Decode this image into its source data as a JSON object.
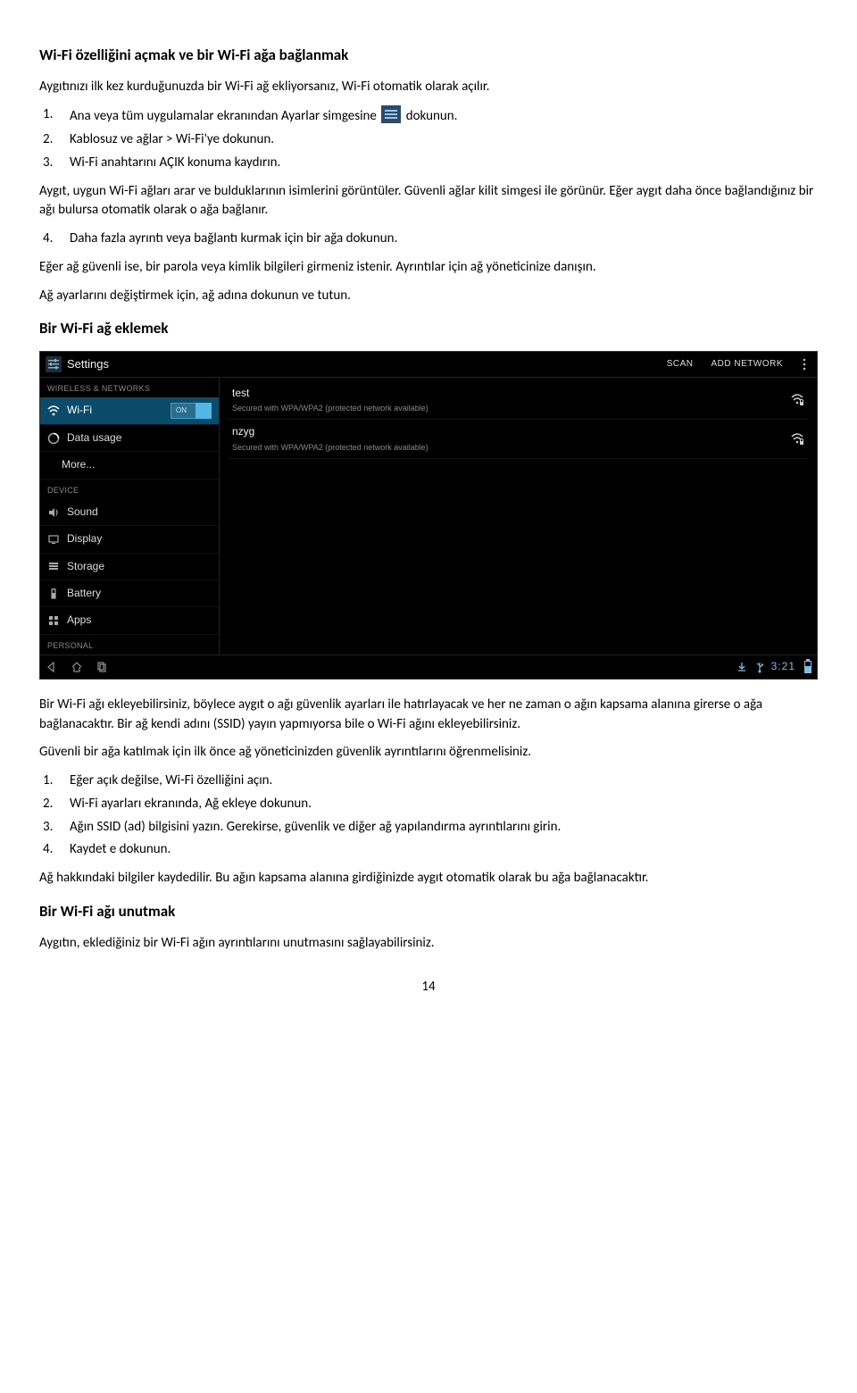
{
  "doc": {
    "h1": "Wi-Fi özelliğini açmak ve bir Wi-Fi ağa bağlanmak",
    "p1": "Aygıtınızı ilk kez kurduğunuzda bir Wi-Fi ağ ekliyorsanız, Wi-Fi otomatik olarak açılır.",
    "s1": {
      "n": "1.",
      "a": "Ana veya tüm uygulamalar ekranından Ayarlar simgesine",
      "b": "dokunun."
    },
    "s2": {
      "n": "2.",
      "t": "Kablosuz ve ağlar > Wi-Fi'ye dokunun."
    },
    "s3": {
      "n": "3.",
      "t": "Wi-Fi anahtarını AÇIK konuma kaydırın."
    },
    "p2": "Aygıt, uygun Wi-Fi ağları arar ve bulduklarının isimlerini görüntüler. Güvenli ağlar kilit simgesi ile görünür. Eğer aygıt daha önce bağlandığınız bir ağı bulursa otomatik olarak o ağa bağlanır.",
    "s4": {
      "n": "4.",
      "t": "Daha fazla ayrıntı veya bağlantı kurmak için bir ağa dokunun."
    },
    "p3": "Eğer ağ güvenli ise, bir parola veya kimlik bilgileri girmeniz istenir. Ayrıntılar için ağ yöneticinize danışın.",
    "p4": "Ağ ayarlarını değiştirmek için, ağ adına dokunun ve tutun.",
    "h2": "Bir Wi-Fi ağ eklemek",
    "p5": "Bir Wi-Fi ağı ekleyebilirsiniz, böylece aygıt o ağı güvenlik ayarları ile hatırlayacak ve her ne zaman o ağın kapsama alanına girerse o ağa bağlanacaktır. Bir ağ kendi adını (SSID) yayın yapmıyorsa bile o Wi-Fi ağını ekleyebilirsiniz.",
    "p6": "Güvenli bir ağa katılmak için ilk önce ağ yöneticinizden güvenlik ayrıntılarını öğrenmelisiniz.",
    "b1": {
      "n": "1.",
      "t": "Eğer açık değilse, Wi-Fi özelliğini açın."
    },
    "b2": {
      "n": "2.",
      "t": "Wi-Fi ayarları ekranında, Ağ ekleye dokunun."
    },
    "b3": {
      "n": "3.",
      "t": "Ağın SSID (ad) bilgisini yazın. Gerekirse, güvenlik ve diğer ağ yapılandırma ayrıntılarını girin."
    },
    "b4": {
      "n": "4.",
      "t": "Kaydet e dokunun."
    },
    "p7": "Ağ hakkındaki bilgiler kaydedilir. Bu ağın kapsama alanına girdiğinizde aygıt otomatik olarak bu ağa bağlanacaktır.",
    "h3": "Bir Wi-Fi ağı unutmak",
    "p8": "Aygıtın, eklediğiniz bir Wi-Fi ağın ayrıntılarını unutmasını sağlayabilirsiniz.",
    "pagenum": "14"
  },
  "ss": {
    "title": "Settings",
    "scan": "SCAN",
    "add": "ADD NETWORK",
    "cat1": "WIRELESS & NETWORKS",
    "wifi": "Wi-Fi",
    "toggle_on": "ON",
    "datausage": "Data usage",
    "more": "More...",
    "cat2": "DEVICE",
    "sound": "Sound",
    "display": "Display",
    "storage": "Storage",
    "battery": "Battery",
    "apps": "Apps",
    "cat3": "PERSONAL",
    "net1_name": "test",
    "net1_sub": "Secured with WPA/WPA2 (protected network available)",
    "net2_name": "nzyg",
    "net2_sub": "Secured with WPA/WPA2 (protected network available)",
    "clock": "3:21"
  }
}
